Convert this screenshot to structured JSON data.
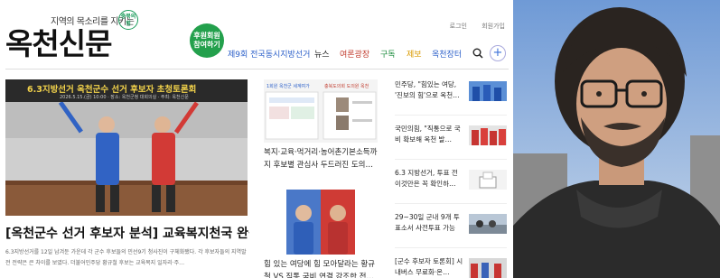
{
  "header": {
    "slogan": "지역의 목소리를 지키는",
    "badge": "충북의 힘",
    "logo": "옥천신문",
    "login": "로그인",
    "signup": "회원가입",
    "support_badge": "후원회원 참여하기"
  },
  "nav": {
    "items": [
      {
        "label": "제9회 전국동시지방선거",
        "color": "#2b5fc9"
      },
      {
        "label": "뉴스",
        "color": "#222222"
      },
      {
        "label": "여론광장",
        "color": "#c0392b"
      },
      {
        "label": "구독",
        "color": "#1e8c3f"
      },
      {
        "label": "제보",
        "color": "#d99a00"
      },
      {
        "label": "옥천장터",
        "color": "#2b5fc9"
      }
    ]
  },
  "lead": {
    "banner_title": "6.3지방선거 옥천군수 선거 후보자 초청토론회",
    "banner_sub": "2026.5.15.(금) 10:00 · 장소: 옥천군청 대회의실 · 주최: 옥천신문",
    "headline": "[옥천군수 선거 후보자 분석] 교육복지천국 완성…",
    "summary": "6.3지방선거를 12일 남겨둔 가운데 각 군수 후보들의 민선9기 청사진이 구체화됐다. 각 후보자들의 지역발전 전략은 큰 차이를 보였다. 더불어민주당 황규철 후보는 교육복지 일자리·주…"
  },
  "middle": {
    "card1": {
      "thumb_caption_left": "1회원 옥천군 세계여가",
      "thumb_caption_right": "충북도의회 도의원 옥천",
      "title": "복지·교육·먹거리·농어촌기본소득까지 후보별 관심사 두드러진 도의…"
    },
    "card2": {
      "title": "힘 있는 여당에 힘 모아달라는 황규철 VS 직통 국비 연결 강조한 전…"
    }
  },
  "sidebar": {
    "items": [
      {
        "text": "민주당, \"힘있는 여당, '진보의 힘'으로 옥천…"
      },
      {
        "text": "국민의힘, \"직통으로 국비 확보해 옥천 발…"
      },
      {
        "text": "6.3 지방선거, 투표 전 이것만은 꼭 확인하…"
      },
      {
        "text": "29~30일 군내 9개 투표소서 사전투표 가능"
      },
      {
        "text": "[군수 후보자 토론회] 시내버스 무료화·온…"
      }
    ]
  },
  "colors": {
    "accent_green": "#23a04c",
    "nav_blue": "#2b5fc9",
    "banner_yellow": "#f2d24b"
  }
}
